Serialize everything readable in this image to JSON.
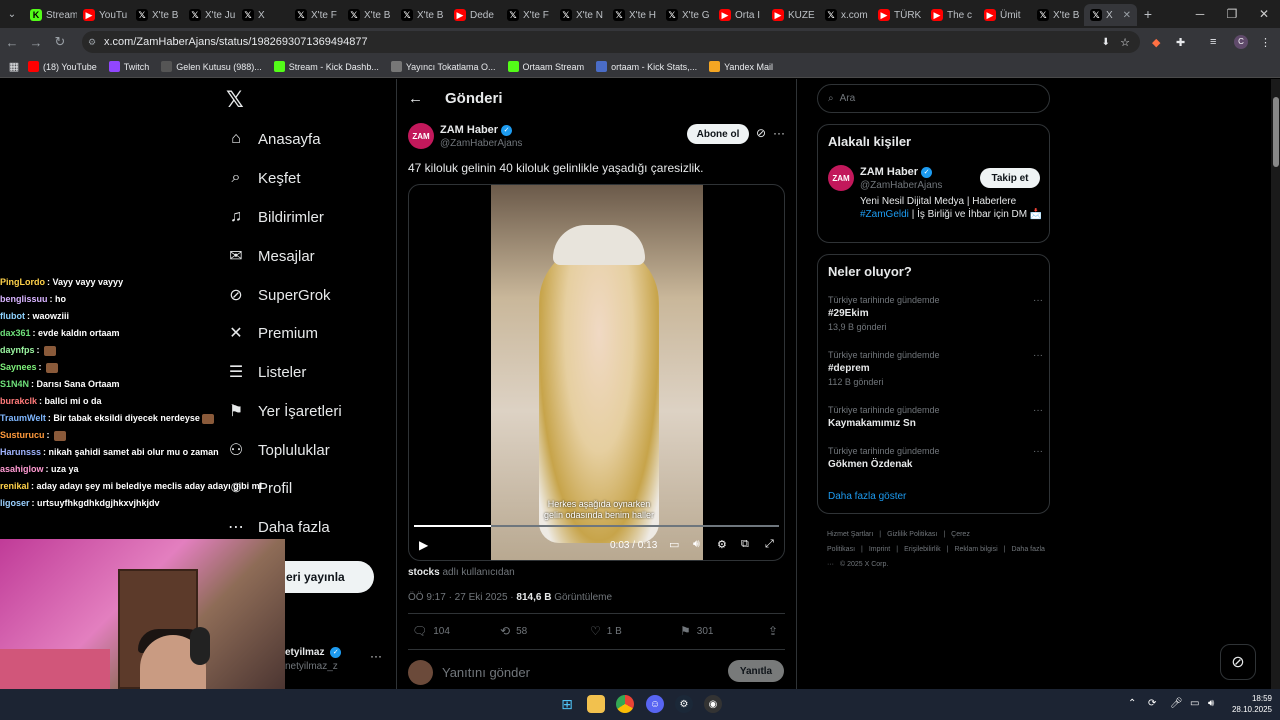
{
  "browser": {
    "tabs": [
      {
        "label": "Stream",
        "fav": "kick",
        "color": "#53fc18"
      },
      {
        "label": "YouTu",
        "fav": "youtube",
        "color": "#ff0000"
      },
      {
        "label": "X'te B",
        "fav": "x",
        "color": "#000000"
      },
      {
        "label": "X'te Ju",
        "fav": "x",
        "color": "#000000"
      },
      {
        "label": "X",
        "fav": "x",
        "color": "#000000"
      },
      {
        "label": "X'te F",
        "fav": "x",
        "color": "#000000"
      },
      {
        "label": "X'te B",
        "fav": "x",
        "color": "#000000"
      },
      {
        "label": "X'te B",
        "fav": "x",
        "color": "#000000"
      },
      {
        "label": "Dede",
        "fav": "youtube",
        "color": "#ff0000"
      },
      {
        "label": "X'te F",
        "fav": "x",
        "color": "#000000"
      },
      {
        "label": "X'te N",
        "fav": "x",
        "color": "#000000"
      },
      {
        "label": "X'te H",
        "fav": "x",
        "color": "#000000"
      },
      {
        "label": "X'te G",
        "fav": "x",
        "color": "#000000"
      },
      {
        "label": "Orta I",
        "fav": "youtube",
        "color": "#ff0000"
      },
      {
        "label": "KUZE",
        "fav": "youtube",
        "color": "#ff0000"
      },
      {
        "label": "x.com",
        "fav": "x",
        "color": "#000000"
      },
      {
        "label": "TÜRK",
        "fav": "youtube",
        "color": "#ff0000"
      },
      {
        "label": "The c",
        "fav": "youtube",
        "color": "#ff0000"
      },
      {
        "label": "Ümit",
        "fav": "youtube",
        "color": "#ff0000"
      },
      {
        "label": "X'te B",
        "fav": "x",
        "color": "#000000"
      },
      {
        "label": "X",
        "fav": "x",
        "color": "#000000"
      }
    ],
    "url": "x.com/ZamHaberAjans/status/1982693071369494877",
    "bookmarks": [
      {
        "label": "(18) YouTube",
        "color": "#ff0000"
      },
      {
        "label": "Twitch",
        "color": "#9146ff"
      },
      {
        "label": "Gelen Kutusu (988)...",
        "color": "#555555"
      },
      {
        "label": "Stream - Kick Dashb...",
        "color": "#53fc18"
      },
      {
        "label": "Yayıncı Tokatlama O...",
        "color": "#777777"
      },
      {
        "label": "Ortaam Stream",
        "color": "#53fc18"
      },
      {
        "label": "ortaam - Kick Stats,...",
        "color": "#4a6cc7"
      },
      {
        "label": "Yandex Mail",
        "color": "#f5a623"
      }
    ]
  },
  "nav": {
    "items": [
      {
        "label": "Anasayfa",
        "icon": "home-icon",
        "glyph": "⌂"
      },
      {
        "label": "Keşfet",
        "icon": "search-icon",
        "glyph": "⌕"
      },
      {
        "label": "Bildirimler",
        "icon": "bell-icon",
        "glyph": "♫"
      },
      {
        "label": "Mesajlar",
        "icon": "mail-icon",
        "glyph": "✉"
      },
      {
        "label": "SuperGrok",
        "icon": "grok-icon",
        "glyph": "⊘"
      },
      {
        "label": "Premium",
        "icon": "x-icon",
        "glyph": "✕"
      },
      {
        "label": "Listeler",
        "icon": "list-icon",
        "glyph": "☰"
      },
      {
        "label": "Yer İşaretleri",
        "icon": "bookmark-icon",
        "glyph": "⚑"
      },
      {
        "label": "Topluluklar",
        "icon": "people-icon",
        "glyph": "⚇"
      },
      {
        "label": "Profil",
        "icon": "profile-icon",
        "glyph": "☺"
      },
      {
        "label": "Daha fazla",
        "icon": "more-circle-icon",
        "glyph": "⋯"
      }
    ],
    "post_button": "eri yayınla",
    "account_name": "etyilmaz",
    "account_handle": "netyilmaz_z"
  },
  "chat": [
    {
      "nick": "PingLordo",
      "color": "#ffd24a",
      "msg": "Vayy vayy vayyy",
      "emote": false
    },
    {
      "nick": "benglissuu",
      "color": "#d8b3ff",
      "msg": "ho",
      "emote": false
    },
    {
      "nick": "flubot",
      "color": "#8fd3ff",
      "msg": "waowziii",
      "emote": false
    },
    {
      "nick": "dax361",
      "color": "#6ee07a",
      "msg": "evde kaldın ortaam",
      "emote": false
    },
    {
      "nick": "daynfps",
      "color": "#9af5a0",
      "msg": "",
      "emote": true
    },
    {
      "nick": "Saynees",
      "color": "#7df07a",
      "msg": "",
      "emote": true
    },
    {
      "nick": "S1N4N",
      "color": "#6ee07a",
      "msg": "Darısı Sana Ortaam",
      "emote": false
    },
    {
      "nick": "burakclk",
      "color": "#ff7a7a",
      "msg": "ballci mi o da",
      "emote": false
    },
    {
      "nick": "TraumWelt",
      "color": "#7fb7ff",
      "msg": "Bir tabak eksildi diyecek nerdeyse",
      "emote": true
    },
    {
      "nick": "Susturucu",
      "color": "#ff9a3c",
      "msg": "",
      "emote": true
    },
    {
      "nick": "Harunsss",
      "color": "#a0b4ff",
      "msg": "nikah şahidi samet abi olur mu o zaman",
      "emote": false
    },
    {
      "nick": "asahiglow",
      "color": "#ff9ad2",
      "msg": "uza ya",
      "emote": false
    },
    {
      "nick": "renikal",
      "color": "#ffd24a",
      "msg": "aday adayı şey mi belediye meclis aday adayı gibi mi",
      "emote": false
    },
    {
      "nick": "ligoser",
      "color": "#9ad0ff",
      "msg": "urtsuyfhkgdhkdgjhkxvjhkjdv",
      "emote": false
    }
  ],
  "header": {
    "title": "Gönderi"
  },
  "tweet": {
    "avatar_text": "ZAM",
    "author": "ZAM Haber",
    "handle": "@ZamHaberAjans",
    "follow_label": "Abone ol",
    "text": "47 kiloluk gelinin 40 kiloluk gelinlikle yaşadığı çaresizlik.",
    "video": {
      "caption_line1": "Herkes aşağıda oynarken",
      "caption_line2": "gelin odasında benim haller",
      "time": "0:03 / 0:13",
      "progress": 0.21
    },
    "source_user": "stocks",
    "source_suffix": "adlı kullanıcıdan",
    "timestamp": "ÖÖ 9:17 · 27 Eki 2025 ·",
    "views": "814,6 B",
    "views_label": "Görüntüleme",
    "replies": "104",
    "reposts": "58",
    "likes": "1 B",
    "bookmarks": "301",
    "reply_placeholder": "Yanıtını gönder",
    "reply_button": "Yanıtla"
  },
  "sidebar": {
    "search_placeholder": "Ara",
    "related_title": "Alakalı kişiler",
    "related": {
      "avatar_text": "ZAM",
      "name": "ZAM Haber",
      "handle": "@ZamHaberAjans",
      "follow": "Takip et",
      "bio_1": "Yeni Nesil Dijital Medya | Haberlere",
      "bio_tag": "#ZamGeldi",
      "bio_2": "| İş Birliği ve İhbar için DM",
      "bio_3": "📩"
    },
    "trends_title": "Neler oluyor?",
    "trends": [
      {
        "context": "Türkiye tarihinde gündemde",
        "name": "#29Ekim",
        "count": "13,9 B gönderi"
      },
      {
        "context": "Türkiye tarihinde gündemde",
        "name": "#deprem",
        "count": "112 B gönderi"
      },
      {
        "context": "Türkiye tarihinde gündemde",
        "name": "Kaymakamımız Sn",
        "count": ""
      },
      {
        "context": "Türkiye tarihinde gündemde",
        "name": "Gökmen Özdenak",
        "count": ""
      }
    ],
    "show_more": "Daha fazla göster",
    "footer": [
      "Hizmet Şartları",
      "|",
      "Gizlilik Politikası",
      "|",
      "Çerez Politikası",
      "|",
      "Imprint",
      "|",
      "Erişilebilirlik",
      "|",
      "Reklam bilgisi",
      "|",
      "Daha fazla ···",
      "© 2025 X Corp."
    ]
  },
  "taskbar": {
    "time": "18:59",
    "date": "28.10.2025"
  }
}
